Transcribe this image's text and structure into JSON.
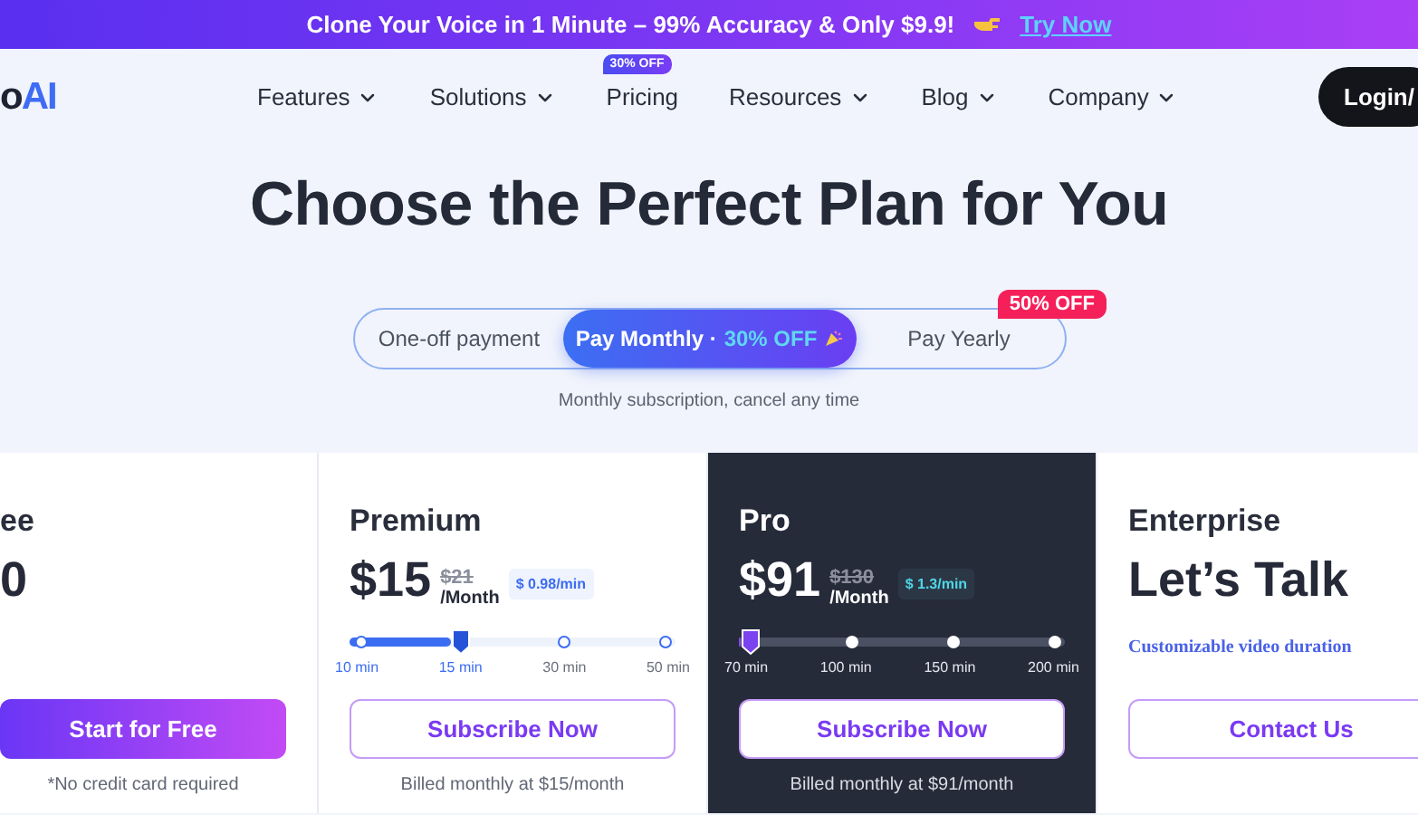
{
  "banner": {
    "text": "Clone Your Voice in 1 Minute – 99% Accuracy & Only $9.9!",
    "link": "Try Now"
  },
  "nav": {
    "logo_a": "o",
    "logo_b": "AI",
    "items": [
      {
        "label": "Features"
      },
      {
        "label": "Solutions"
      },
      {
        "label": "Pricing",
        "badge": "30% OFF"
      },
      {
        "label": "Resources"
      },
      {
        "label": "Blog"
      },
      {
        "label": "Company"
      }
    ],
    "login": "Login/"
  },
  "heading": "Choose the Perfect Plan for You",
  "billing": {
    "options": [
      {
        "label": "One-off payment",
        "selected": false
      },
      {
        "label": "Pay Monthly ·",
        "discount": "30% OFF",
        "selected": true
      },
      {
        "label": "Pay Yearly",
        "badge": "50% OFF",
        "selected": false
      }
    ],
    "note": "Monthly subscription, cancel any time"
  },
  "plans": [
    {
      "kind": "free",
      "name": "ee",
      "price": "0",
      "button": "Start for Free",
      "note": "*No credit card required"
    },
    {
      "kind": "standard",
      "name": "Premium",
      "price": "$15",
      "old_price": "$21",
      "unit": "/Month",
      "rate": "$ 0.98/min",
      "slider": {
        "level": 0.333,
        "stops": [
          "10 min",
          "15 min",
          "30 min",
          "50 min"
        ]
      },
      "button": "Subscribe Now",
      "note": "Billed monthly at $15/month"
    },
    {
      "kind": "featured",
      "name": "Pro",
      "price": "$91",
      "old_price": "$130",
      "unit": "/Month",
      "rate": "$ 1.3/min",
      "slider": {
        "level": 0,
        "stops": [
          "70 min",
          "100 min",
          "150 min",
          "200 min"
        ]
      },
      "button": "Subscribe Now",
      "note": "Billed monthly at $91/month"
    },
    {
      "kind": "standard",
      "name": "Enterprise",
      "price": "Let’s Talk",
      "description": "Customizable video duration",
      "button": "Contact Us"
    }
  ]
}
